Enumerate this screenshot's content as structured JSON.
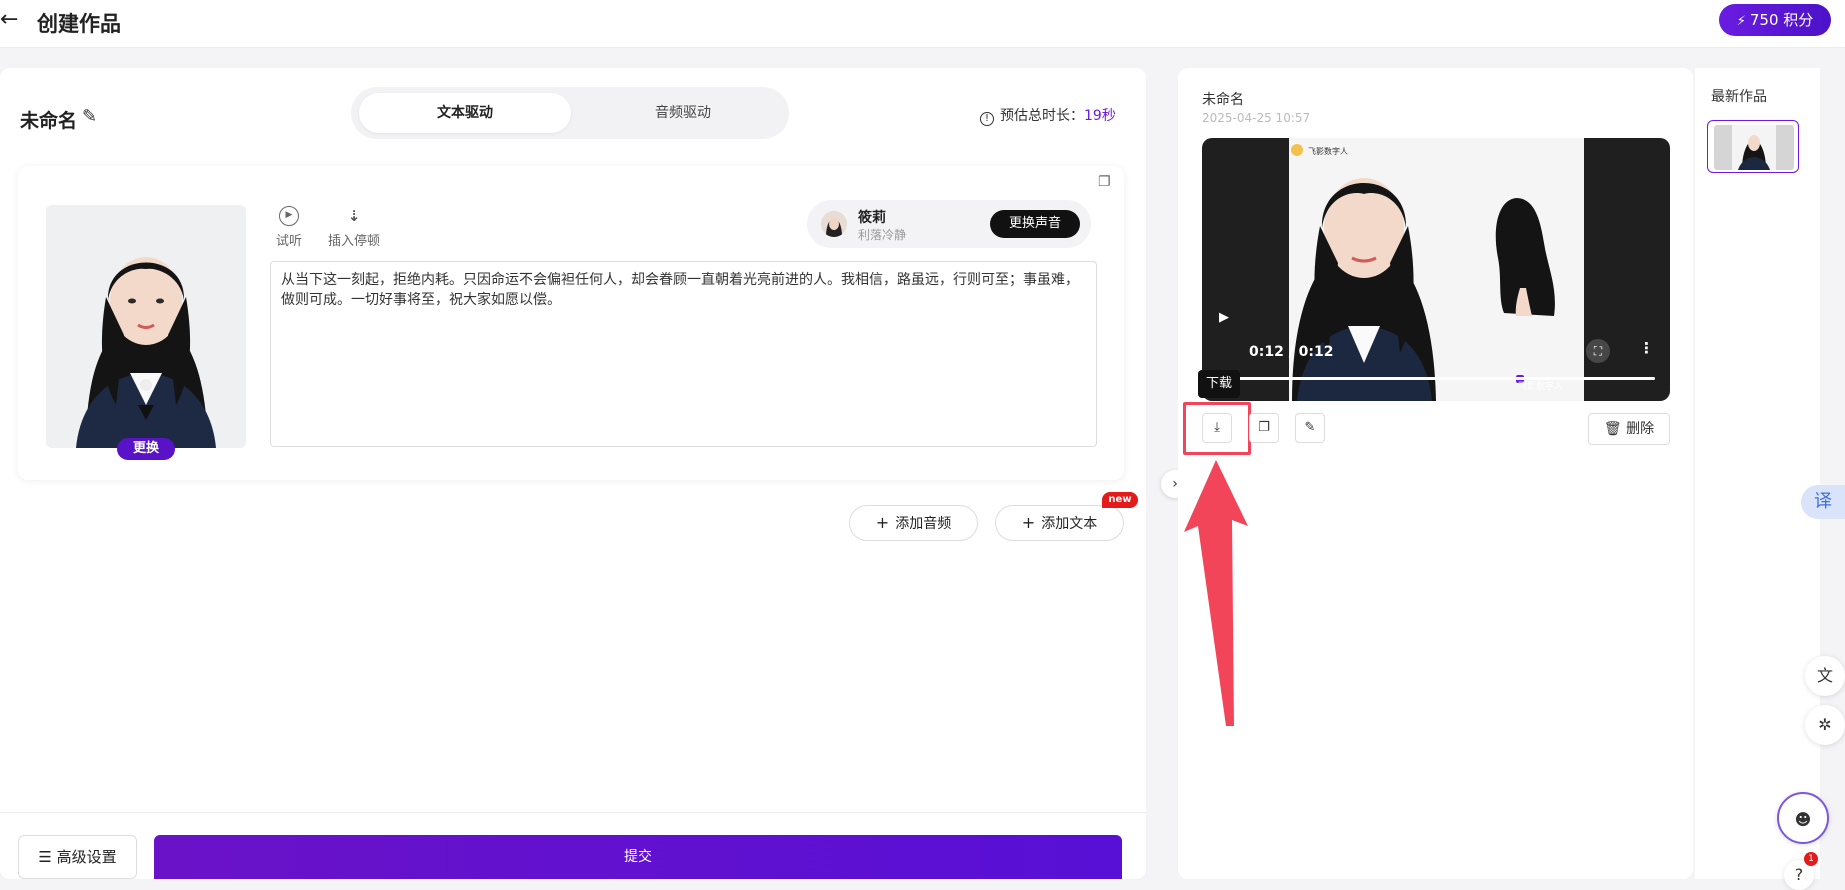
{
  "header": {
    "back_label": "←",
    "title": "创建作品",
    "points": "750 积分"
  },
  "editor": {
    "work_name": "未命名",
    "tabs": [
      {
        "label": "文本驱动",
        "active": true
      },
      {
        "label": "音频驱动",
        "active": false
      }
    ],
    "estimate_label": "预估总时长：",
    "estimate_value": "19秒",
    "swap_label": "更换",
    "tools": {
      "listen": "试听",
      "pause": "插入停顿"
    },
    "voice": {
      "name": "筱莉",
      "desc": "利落冷静",
      "change_label": "更换声音"
    },
    "text": "从当下这一刻起，拒绝内耗。只因命运不会偏袒任何人，却会眷顾一直朝着光亮前进的人。我相信，路虽远，行则可至；事虽难，做则可成。一切好事将至，祝大家如愿以偿。",
    "add_audio": "添加音频",
    "add_text": "添加文本",
    "new_badge": "new",
    "advanced_label": "高级设置",
    "submit_label": "提交"
  },
  "preview": {
    "title": "未命名",
    "date": "2025-04-25 10:57",
    "video_time": "0:12 / 0:12",
    "video_logo": "飞影数字人",
    "video_corner_text": "飞影数字人",
    "tooltip": "下载",
    "delete_label": "删除"
  },
  "latest": {
    "title": "最新作品"
  },
  "floating": {
    "translate": "译",
    "notif_count": "1"
  },
  "colors": {
    "accent": "#6a1ce0",
    "highlight": "#f2455a",
    "badge": "#e31b1b"
  }
}
